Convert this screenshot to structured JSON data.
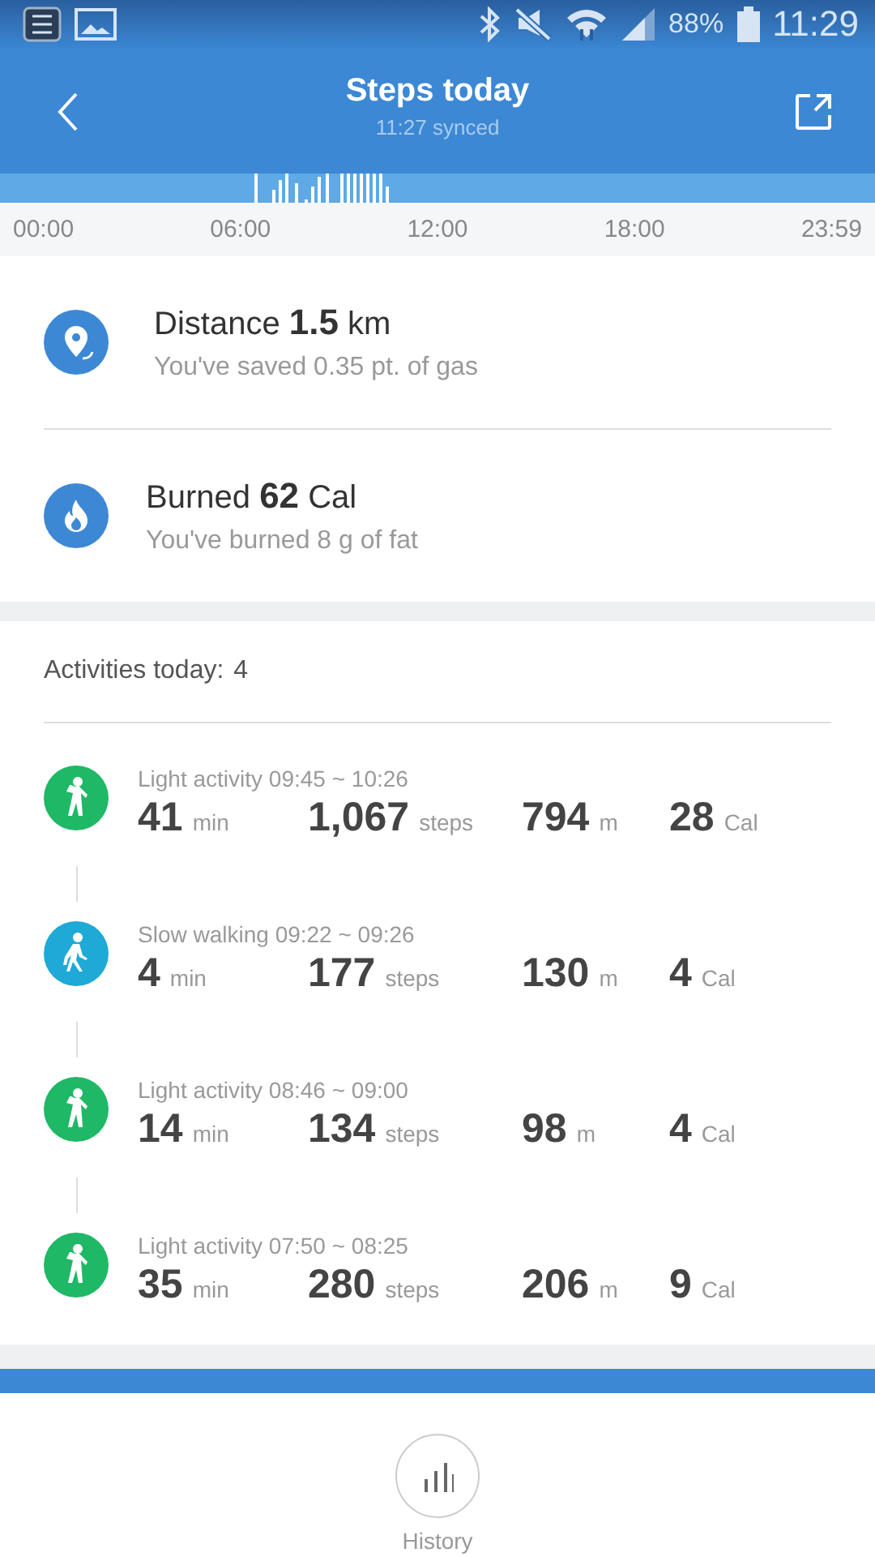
{
  "status_bar": {
    "battery": "88%",
    "time": "11:29"
  },
  "header": {
    "title": "Steps today",
    "subtitle": "11:27 synced"
  },
  "timeline": {
    "labels": [
      "00:00",
      "06:00",
      "12:00",
      "18:00",
      "23:59"
    ]
  },
  "summary": [
    {
      "kind": "distance",
      "label": "Distance",
      "value": "1.5",
      "unit": "km",
      "note": "You've saved 0.35 pt. of gas"
    },
    {
      "kind": "burned",
      "label": "Burned",
      "value": "62",
      "unit": "Cal",
      "note": "You've burned 8 g of fat"
    }
  ],
  "activities": {
    "label": "Activities today:",
    "count": "4",
    "items": [
      {
        "kind": "light",
        "color": "#1fb866",
        "title": "Light activity 09:45 ~ 10:26",
        "stats": [
          {
            "value": "41",
            "unit": "min"
          },
          {
            "value": "1,067",
            "unit": "steps"
          },
          {
            "value": "794",
            "unit": "m"
          },
          {
            "value": "28",
            "unit": "Cal"
          }
        ]
      },
      {
        "kind": "walk",
        "color": "#1ea9d6",
        "title": "Slow walking 09:22 ~ 09:26",
        "stats": [
          {
            "value": "4",
            "unit": "min"
          },
          {
            "value": "177",
            "unit": "steps"
          },
          {
            "value": "130",
            "unit": "m"
          },
          {
            "value": "4",
            "unit": "Cal"
          }
        ]
      },
      {
        "kind": "light",
        "color": "#1fb866",
        "title": "Light activity 08:46 ~ 09:00",
        "stats": [
          {
            "value": "14",
            "unit": "min"
          },
          {
            "value": "134",
            "unit": "steps"
          },
          {
            "value": "98",
            "unit": "m"
          },
          {
            "value": "4",
            "unit": "Cal"
          }
        ]
      },
      {
        "kind": "light",
        "color": "#1fb866",
        "title": "Light activity 07:50 ~ 08:25",
        "stats": [
          {
            "value": "35",
            "unit": "min"
          },
          {
            "value": "280",
            "unit": "steps"
          },
          {
            "value": "206",
            "unit": "m"
          },
          {
            "value": "9",
            "unit": "Cal"
          }
        ]
      }
    ]
  },
  "footer": {
    "button": "History"
  }
}
